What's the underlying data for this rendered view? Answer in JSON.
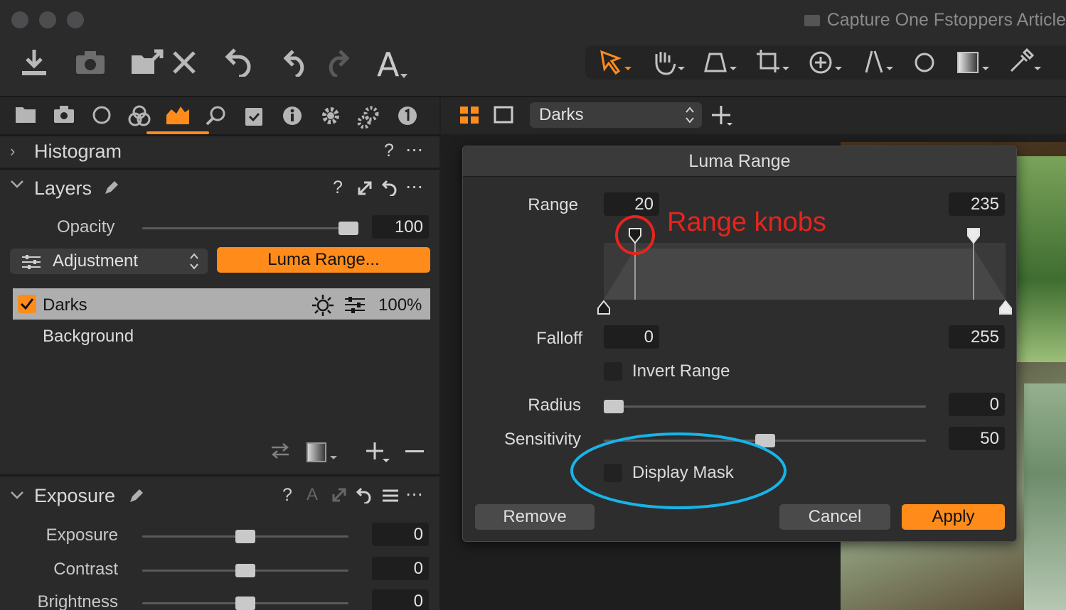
{
  "window": {
    "title": "Capture One Fstoppers Article"
  },
  "toolbar": {
    "icons": [
      "import-icon",
      "camera-icon",
      "export-icon",
      "delete-icon",
      "undo-icon",
      "rotate-left-icon",
      "rotate-right-icon",
      "text-icon"
    ],
    "cursor_tools": [
      "select-cursor-icon",
      "pan-hand-icon",
      "keystone-icon",
      "crop-icon",
      "rotate-icon",
      "straighten-icon",
      "spot-icon",
      "gradient-icon",
      "picker-icon"
    ]
  },
  "tool_tabs": [
    "folder-icon",
    "camera-icon",
    "circle-icon",
    "color-icon",
    "exposure-tab-icon",
    "search-icon",
    "clipboard-icon",
    "info-icon",
    "gear-icon",
    "adjustments-icon",
    "badge-icon"
  ],
  "histogram": {
    "title": "Histogram",
    "help": "?",
    "more": "⋯"
  },
  "layers": {
    "title": "Layers",
    "help": "?",
    "more": "⋯",
    "opacity_label": "Opacity",
    "opacity_value": "100",
    "opacity_level": 1.0,
    "adjustment_label": "Adjustment",
    "luma_button": "Luma Range...",
    "items": [
      {
        "name": "Darks",
        "percent": "100%",
        "checked": true
      },
      {
        "name": "Background"
      }
    ]
  },
  "exposure": {
    "title": "Exposure",
    "help": "?",
    "more": "⋯",
    "sliders": [
      {
        "label": "Exposure",
        "value": "0",
        "level": 0.5
      },
      {
        "label": "Contrast",
        "value": "0",
        "level": 0.5
      },
      {
        "label": "Brightness",
        "value": "0",
        "level": 0.5
      }
    ]
  },
  "viewer": {
    "layer_select": "Darks"
  },
  "luma_dialog": {
    "title": "Luma Range",
    "range_label": "Range",
    "range_low": "20",
    "range_high": "235",
    "annotation": "Range knobs",
    "falloff_label": "Falloff",
    "falloff_low": "0",
    "falloff_high": "255",
    "invert_label": "Invert Range",
    "radius_label": "Radius",
    "radius_value": "0",
    "radius_level": 0.0,
    "sensitivity_label": "Sensitivity",
    "sensitivity_value": "50",
    "sensitivity_level": 0.5,
    "display_mask_label": "Display Mask",
    "remove_button": "Remove",
    "cancel_button": "Cancel",
    "apply_button": "Apply"
  },
  "colors": {
    "accent": "#ff8c1a",
    "annotation_red": "#e8241b",
    "annotation_blue": "#16b4e8"
  }
}
